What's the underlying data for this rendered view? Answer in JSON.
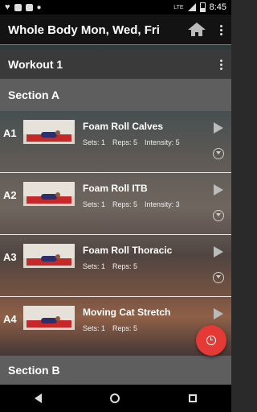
{
  "statusbar": {
    "time": "8:45",
    "network": "LTE"
  },
  "appbar": {
    "title": "Whole Body Mon, Wed, Fri"
  },
  "workout": {
    "title": "Workout 1"
  },
  "sections": [
    {
      "title": "Section A"
    },
    {
      "title": "Section B"
    }
  ],
  "exercises": [
    {
      "label": "A1",
      "name": "Foam Roll Calves",
      "sets": "Sets: 1",
      "reps": "Reps: 5",
      "intensity": "Intensity: 5"
    },
    {
      "label": "A2",
      "name": "Foam Roll ITB",
      "sets": "Sets: 1",
      "reps": "Reps: 5",
      "intensity": "Intensity: 3"
    },
    {
      "label": "A3",
      "name": "Foam Roll Thoracic",
      "sets": "Sets: 1",
      "reps": "Reps: 5"
    },
    {
      "label": "A4",
      "name": "Moving Cat Stretch",
      "sets": "Sets: 1",
      "reps": "Reps: 5"
    }
  ],
  "colors": {
    "fab": "#e53935",
    "section_bg": "#5e5e5e",
    "appbar_bg": "#131313"
  },
  "icons": [
    "home-icon",
    "more-vert-icon",
    "play-icon",
    "expand-icon",
    "alarm-icon",
    "back-icon",
    "home-nav-icon",
    "recents-icon"
  ]
}
